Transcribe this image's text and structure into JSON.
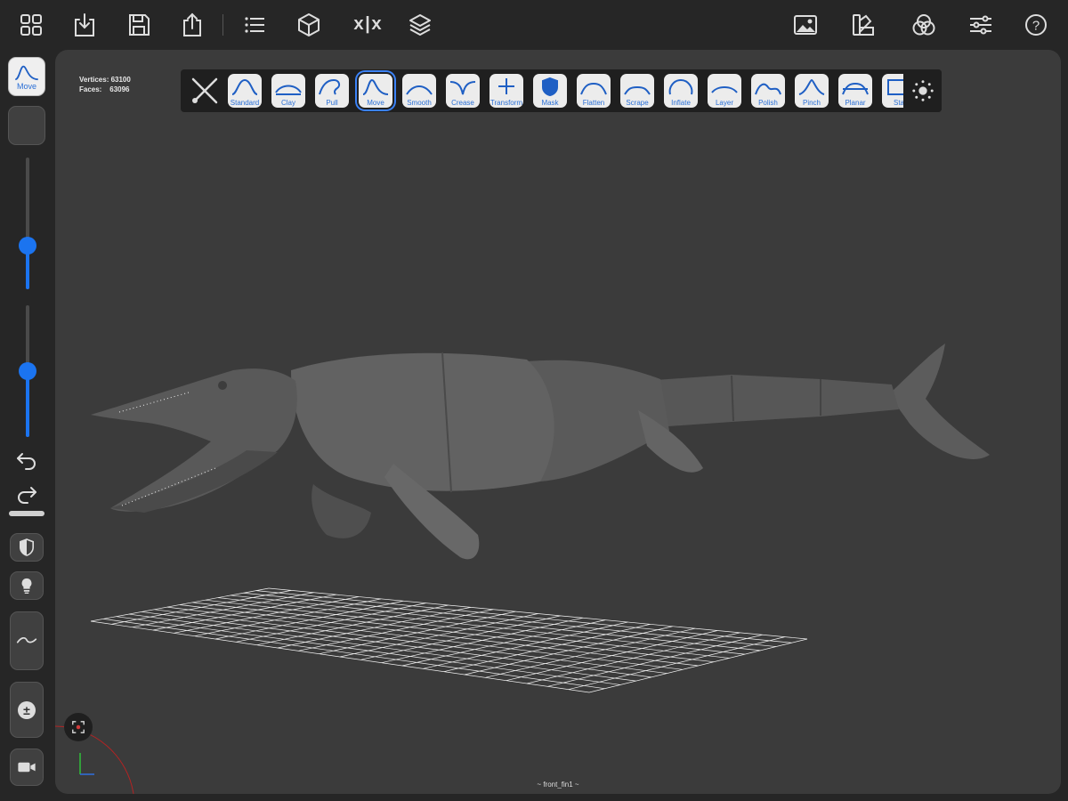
{
  "topbar": {
    "left_icons": [
      "grid-icon",
      "import-icon",
      "save-icon",
      "share-icon",
      "list-icon",
      "cube-icon",
      "symmetry-icon",
      "layers-icon"
    ],
    "symmetry_label": "x|x",
    "right_icons": [
      "image-icon",
      "palette-icon",
      "color-circles-icon",
      "sliders-icon",
      "help-icon"
    ],
    "help_label": "?"
  },
  "viewport": {
    "vertices_label": "Vertices: 63100",
    "faces_label": "Faces:    63096",
    "selection_label": "~ front_fin1 ~"
  },
  "toolbar": {
    "tools": [
      {
        "label": "Standard",
        "icon": "standard-brush-icon"
      },
      {
        "label": "Clay",
        "icon": "clay-brush-icon"
      },
      {
        "label": "Pull",
        "icon": "pull-brush-icon"
      },
      {
        "label": "Move",
        "icon": "move-brush-icon"
      },
      {
        "label": "Smooth",
        "icon": "smooth-brush-icon"
      },
      {
        "label": "Crease",
        "icon": "crease-brush-icon"
      },
      {
        "label": "Transform",
        "icon": "transform-brush-icon"
      },
      {
        "label": "Mask",
        "icon": "mask-brush-icon"
      },
      {
        "label": "Flatten",
        "icon": "flatten-brush-icon"
      },
      {
        "label": "Scrape",
        "icon": "scrape-brush-icon"
      },
      {
        "label": "Inflate",
        "icon": "inflate-brush-icon"
      },
      {
        "label": "Layer",
        "icon": "layer-brush-icon"
      },
      {
        "label": "Polish",
        "icon": "polish-brush-icon"
      },
      {
        "label": "Pinch",
        "icon": "pinch-brush-icon"
      },
      {
        "label": "Planar",
        "icon": "planar-brush-icon"
      },
      {
        "label": "Sta",
        "icon": "stamp-brush-icon"
      }
    ],
    "active_tool": "Move"
  },
  "leftpanel": {
    "current_tool_label": "Move",
    "radius_level": 0.33,
    "intensity_level": 0.5,
    "undo_icon": "undo-icon",
    "redo_icon": "redo-icon",
    "mask_icon": "mask-toggle-icon",
    "light_icon": "lightbulb-icon",
    "stroke_icon": "stroke-curve-icon",
    "plus_minus_label": "±",
    "camera_icon": "camera-icon"
  },
  "colors": {
    "accent": "#1b74f0",
    "background": "#262626",
    "viewport": "#3b3b3b",
    "tool_bg": "#ececec"
  }
}
